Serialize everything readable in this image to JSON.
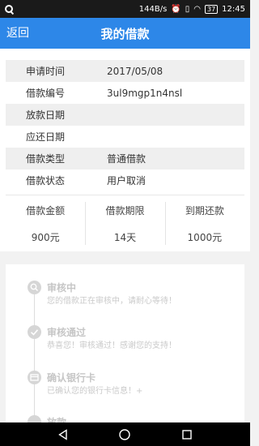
{
  "status_bar": {
    "speed": "144B/s",
    "battery": "37",
    "time": "12:45"
  },
  "nav": {
    "back_label": "返回",
    "title": "我的借款"
  },
  "details": [
    {
      "key": "申请时间",
      "value": "2017/05/08"
    },
    {
      "key": "借款编号",
      "value": "3ul9mgp1n4nsl"
    },
    {
      "key": "放款日期",
      "value": ""
    },
    {
      "key": "应还日期",
      "value": ""
    },
    {
      "key": "借款类型",
      "value": "普通借款"
    },
    {
      "key": "借款状态",
      "value": "用户取消"
    }
  ],
  "stats": [
    {
      "label": "借款金额",
      "value": "900元"
    },
    {
      "label": "借款期限",
      "value": "14天"
    },
    {
      "label": "到期还款",
      "value": "1000元"
    }
  ],
  "steps": [
    {
      "title": "审核中",
      "desc": "您的借款正在审核中，请耐心等待！",
      "icon": "search-icon"
    },
    {
      "title": "审核通过",
      "desc": "恭喜您！审核通过！感谢您的支持！",
      "icon": "check-icon"
    },
    {
      "title": "确认银行卡",
      "desc": "已确认您的银行卡信息！+",
      "icon": "card-icon"
    },
    {
      "title": "放款",
      "desc": "",
      "icon": "money-icon"
    }
  ]
}
